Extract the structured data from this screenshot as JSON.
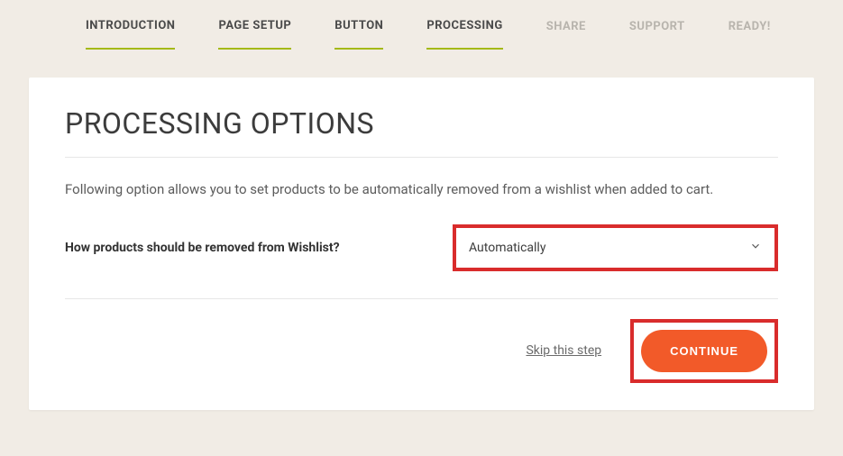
{
  "tabs": [
    {
      "label": "INTRODUCTION",
      "state": "active"
    },
    {
      "label": "PAGE SETUP",
      "state": "active"
    },
    {
      "label": "BUTTON",
      "state": "active"
    },
    {
      "label": "PROCESSING",
      "state": "active"
    },
    {
      "label": "SHARE",
      "state": "disabled"
    },
    {
      "label": "SUPPORT",
      "state": "disabled"
    },
    {
      "label": "READY!",
      "state": "disabled"
    }
  ],
  "colors": {
    "accent": "#a4b918",
    "primary_button": "#f25a29",
    "highlight_border": "#d92c2c"
  },
  "card": {
    "title": "PROCESSING OPTIONS",
    "description": "Following option allows you to set products to be automatically removed from a wishlist when added to cart.",
    "field_label": "How products should be removed from Wishlist?",
    "select_value": "Automatically"
  },
  "footer": {
    "skip_label": "Skip this step",
    "continue_label": "CONTINUE"
  }
}
